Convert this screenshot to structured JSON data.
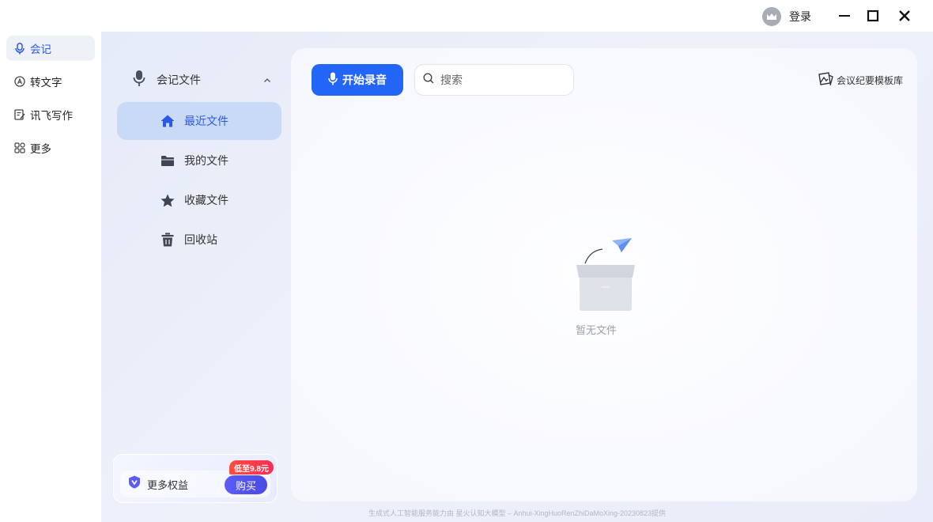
{
  "titlebar": {
    "login_label": "登录",
    "minimize_icon": "minimize-icon",
    "maximize_icon": "maximize-icon",
    "close_icon": "close-icon"
  },
  "leftnav": {
    "items": [
      {
        "label": "会记",
        "icon": "microphone-icon",
        "active": true
      },
      {
        "label": "转文字",
        "icon": "text-convert-icon",
        "active": false
      },
      {
        "label": "讯飞写作",
        "icon": "writing-icon",
        "active": false
      },
      {
        "label": "更多",
        "icon": "grid-icon",
        "active": false
      }
    ]
  },
  "filepanel": {
    "header": "会记文件",
    "items": [
      {
        "label": "最近文件",
        "icon": "home-icon",
        "active": true
      },
      {
        "label": "我的文件",
        "icon": "folder-icon",
        "active": false
      },
      {
        "label": "收藏文件",
        "icon": "star-icon",
        "active": false
      },
      {
        "label": "回收站",
        "icon": "trash-icon",
        "active": false
      }
    ],
    "promo": {
      "label": "更多权益",
      "badge": "低至9.8元",
      "buy_label": "购买"
    }
  },
  "main": {
    "record_label": "开始录音",
    "search_placeholder": "搜索",
    "template_link": "会议纪要模板库",
    "empty_text": "暂无文件"
  },
  "footer": {
    "text": "生成式人工智能服务能力由 星火认知大模型 – Anhui-XingHuoRenZhiDaMoXing-20230823提供"
  },
  "colors": {
    "accent": "#2365f6",
    "active_nav_text": "#2b5ae8",
    "active_file_bg": "#c9daf7",
    "badge_red": "#ff3b3b",
    "buy_purple": "#5151ee"
  }
}
